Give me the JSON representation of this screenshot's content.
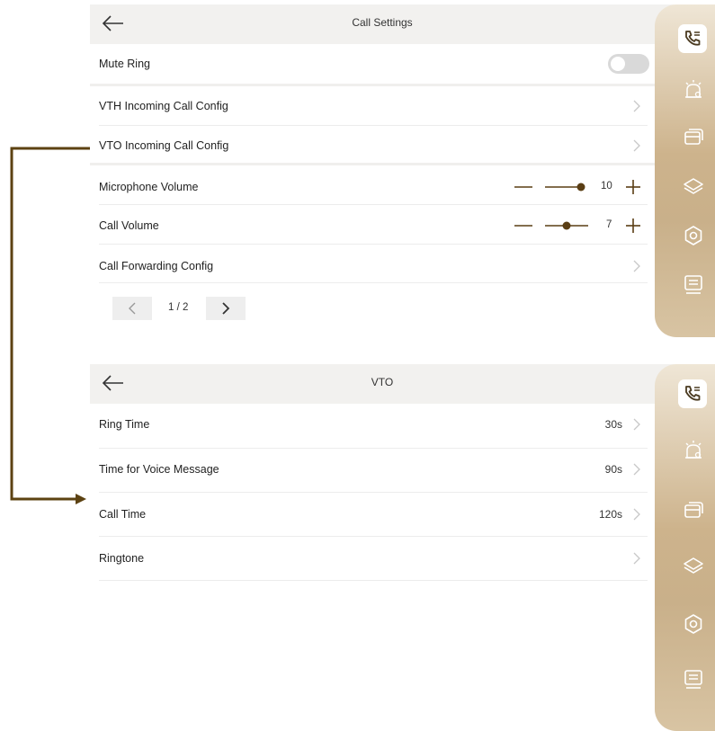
{
  "call_settings": {
    "title": "Call Settings",
    "mute_ring": {
      "label": "Mute Ring",
      "enabled": false
    },
    "vth_incoming": "VTH Incoming Call Config",
    "vto_incoming": "VTO Incoming Call Config",
    "microphone_volume": {
      "label": "Microphone Volume",
      "value": "10"
    },
    "call_volume": {
      "label": "Call Volume",
      "value": "7"
    },
    "call_forwarding": "Call Forwarding Config",
    "page_indicator": "1 / 2"
  },
  "vto": {
    "title": "VTO",
    "items": [
      {
        "label": "Ring Time",
        "value": "30s"
      },
      {
        "label": "Time for Voice Message",
        "value": "90s"
      },
      {
        "label": "Call Time",
        "value": "120s"
      },
      {
        "label": "Ringtone",
        "value": ""
      }
    ]
  },
  "sidebar": {
    "icons": [
      "call-settings-icon",
      "alarm-icon",
      "card-icon",
      "layers-icon",
      "gear-icon",
      "info-list-icon"
    ],
    "active_index": 0
  },
  "colors": {
    "accent": "#5a3e14",
    "connector": "#5c4212",
    "sidebar_gold": "#c9b08a"
  }
}
